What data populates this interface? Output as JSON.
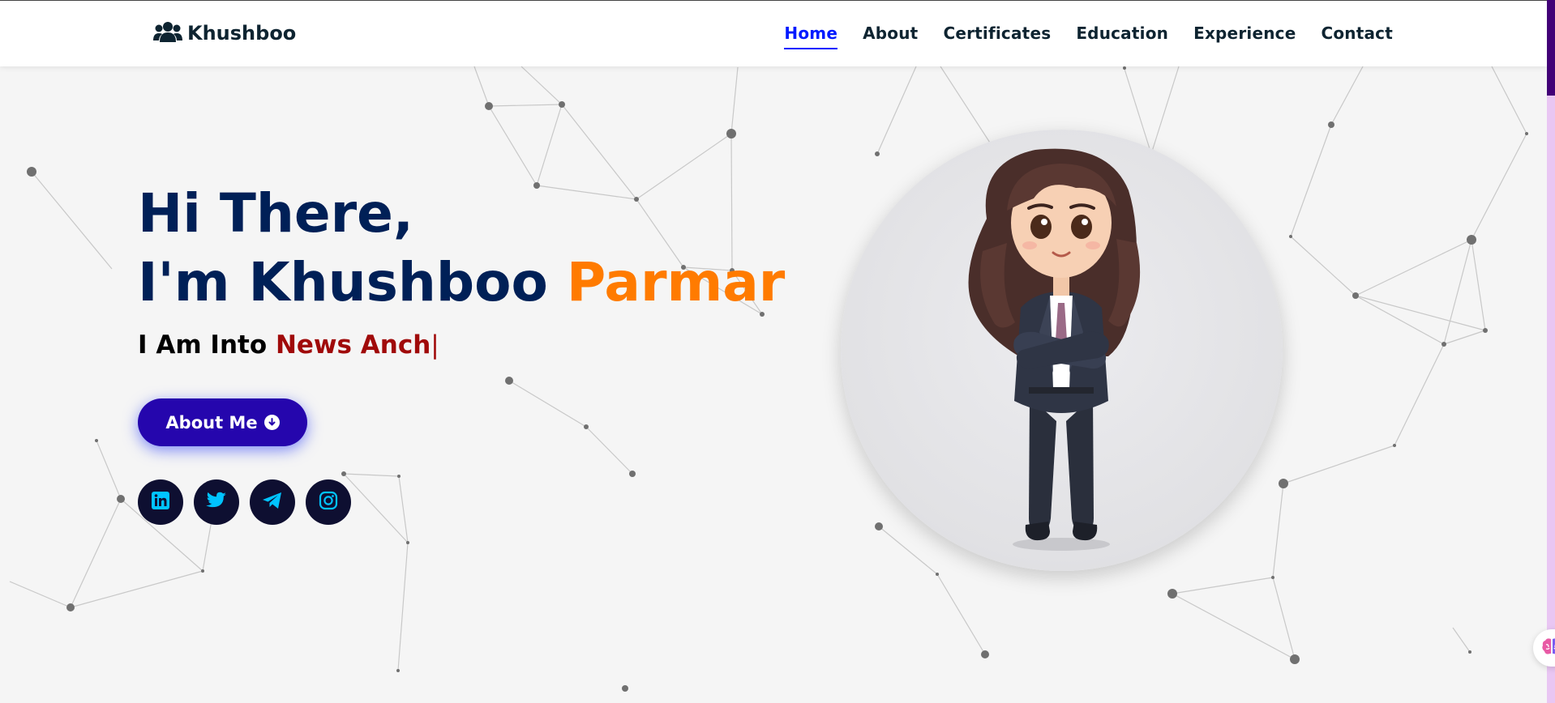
{
  "colors": {
    "nav_text": "#0e2431",
    "nav_active": "#011aff",
    "heading": "#002057",
    "accent_orange": "#ff7b00",
    "typing_red": "#a00a0a",
    "button_bg": "#2506ad",
    "social_bg": "#0e0f31",
    "social_icon": "#00c3ff",
    "scroll_thumb": "#420177",
    "scroll_track": "#e9c6f3"
  },
  "brand": {
    "icon": "users-icon",
    "name": "Khushboo"
  },
  "nav": {
    "items": [
      {
        "label": "Home",
        "active": true
      },
      {
        "label": "About",
        "active": false
      },
      {
        "label": "Certificates",
        "active": false
      },
      {
        "label": "Education",
        "active": false
      },
      {
        "label": "Experience",
        "active": false
      },
      {
        "label": "Contact",
        "active": false
      }
    ]
  },
  "hero": {
    "greeting": "Hi There,",
    "intro": "I'm Khushboo",
    "surname": "Parmar",
    "typing_prefix": "I Am Into",
    "typing_word": "News Anch",
    "caret": "|"
  },
  "cta": {
    "label": "About Me",
    "icon": "arrow-down-circle-icon"
  },
  "socials": [
    {
      "name": "linkedin",
      "icon": "linkedin-icon"
    },
    {
      "name": "twitter",
      "icon": "twitter-icon"
    },
    {
      "name": "telegram",
      "icon": "telegram-icon"
    },
    {
      "name": "instagram",
      "icon": "instagram-icon"
    }
  ],
  "avatar": {
    "icon": "cartoon-woman-avatar"
  },
  "floating": {
    "icon": "brain-icon"
  }
}
